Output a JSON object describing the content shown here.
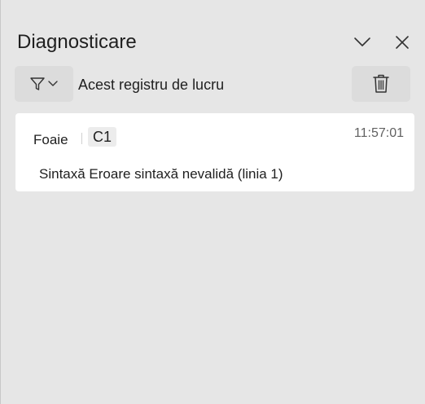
{
  "pane": {
    "title": "Diagnosticare",
    "collapse_icon": "chevron-down-icon",
    "close_icon": "close-icon"
  },
  "toolbar": {
    "filter_icon": "filter-icon",
    "filter_dropdown_icon": "chevron-down-icon",
    "scope_label": "Acest registru de lucru",
    "delete_icon": "trash-icon"
  },
  "entries": [
    {
      "sheet_label": "Foaie",
      "cell": "C1",
      "time": "11:57:01",
      "message": "Sintaxă Eroare sintaxă nevalidă (linia 1)"
    }
  ],
  "colors": {
    "background": "#e6e6e6",
    "card": "#ffffff",
    "button": "#dcdcdc",
    "text": "#1f1f1f",
    "muted_text": "#616161"
  }
}
